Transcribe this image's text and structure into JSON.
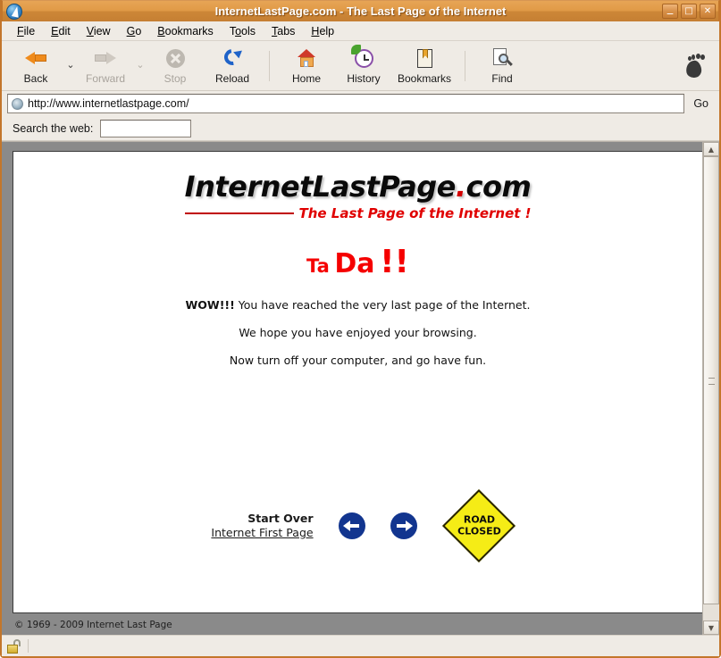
{
  "window": {
    "title": "InternetLastPage.com - The Last Page of the Internet",
    "icon": "browser-globe-icon",
    "buttons": {
      "minimize": "_",
      "maximize": "□",
      "close": "✕"
    }
  },
  "menubar": {
    "items": [
      {
        "label": "File",
        "mnemonic": "F"
      },
      {
        "label": "Edit",
        "mnemonic": "E"
      },
      {
        "label": "View",
        "mnemonic": "V"
      },
      {
        "label": "Go",
        "mnemonic": "G"
      },
      {
        "label": "Bookmarks",
        "mnemonic": "B"
      },
      {
        "label": "Tools",
        "mnemonic": "o"
      },
      {
        "label": "Tabs",
        "mnemonic": "T"
      },
      {
        "label": "Help",
        "mnemonic": "H"
      }
    ]
  },
  "toolbar": {
    "back_label": "Back",
    "forward_label": "Forward",
    "stop_label": "Stop",
    "reload_label": "Reload",
    "home_label": "Home",
    "history_label": "History",
    "bookmarks_label": "Bookmarks",
    "find_label": "Find",
    "dropdown_glyph": "⌄"
  },
  "addressbar": {
    "url": "http://www.internetlastpage.com/",
    "go_label": "Go",
    "favicon": "site-favicon"
  },
  "searchbar": {
    "label": "Search the web:",
    "value": "",
    "placeholder": ""
  },
  "page": {
    "logo": {
      "part1": "InternetLastPage",
      "dot": ".",
      "part2": "com",
      "tagline": "The Last Page of the Internet !"
    },
    "headline": {
      "ta": "Ta",
      "da": "Da",
      "bang": "!!"
    },
    "lines": [
      {
        "bold": "WOW!!!",
        "rest": " You have reached the very last page of the Internet."
      },
      {
        "bold": "",
        "rest": "We hope you have enjoyed your browsing."
      },
      {
        "bold": "",
        "rest": "Now turn off your computer, and go have fun."
      }
    ],
    "nav": {
      "start_over": "Start Over",
      "first_page_link": "Internet First Page",
      "left_arrow": "left-arrow-icon",
      "right_arrow": "right-arrow-icon",
      "road_sign_line1": "ROAD",
      "road_sign_line2": "CLOSED"
    },
    "copyright": "© 1969 - 2009 Internet Last Page"
  },
  "scrollbar": {
    "up_glyph": "▲",
    "down_glyph": "▼"
  },
  "statusbar": {
    "security": "unlocked-padlock-icon",
    "text": ""
  },
  "colors": {
    "titlebar_light": "#e7a556",
    "titlebar_dark": "#c57f33",
    "chrome_bg": "#efebe5",
    "logo_red": "#d40000",
    "tada_red": "#f50000",
    "arrow_blue": "#12358f",
    "sign_yellow": "#f5ec16",
    "viewport_gray": "#8a8a8a"
  }
}
